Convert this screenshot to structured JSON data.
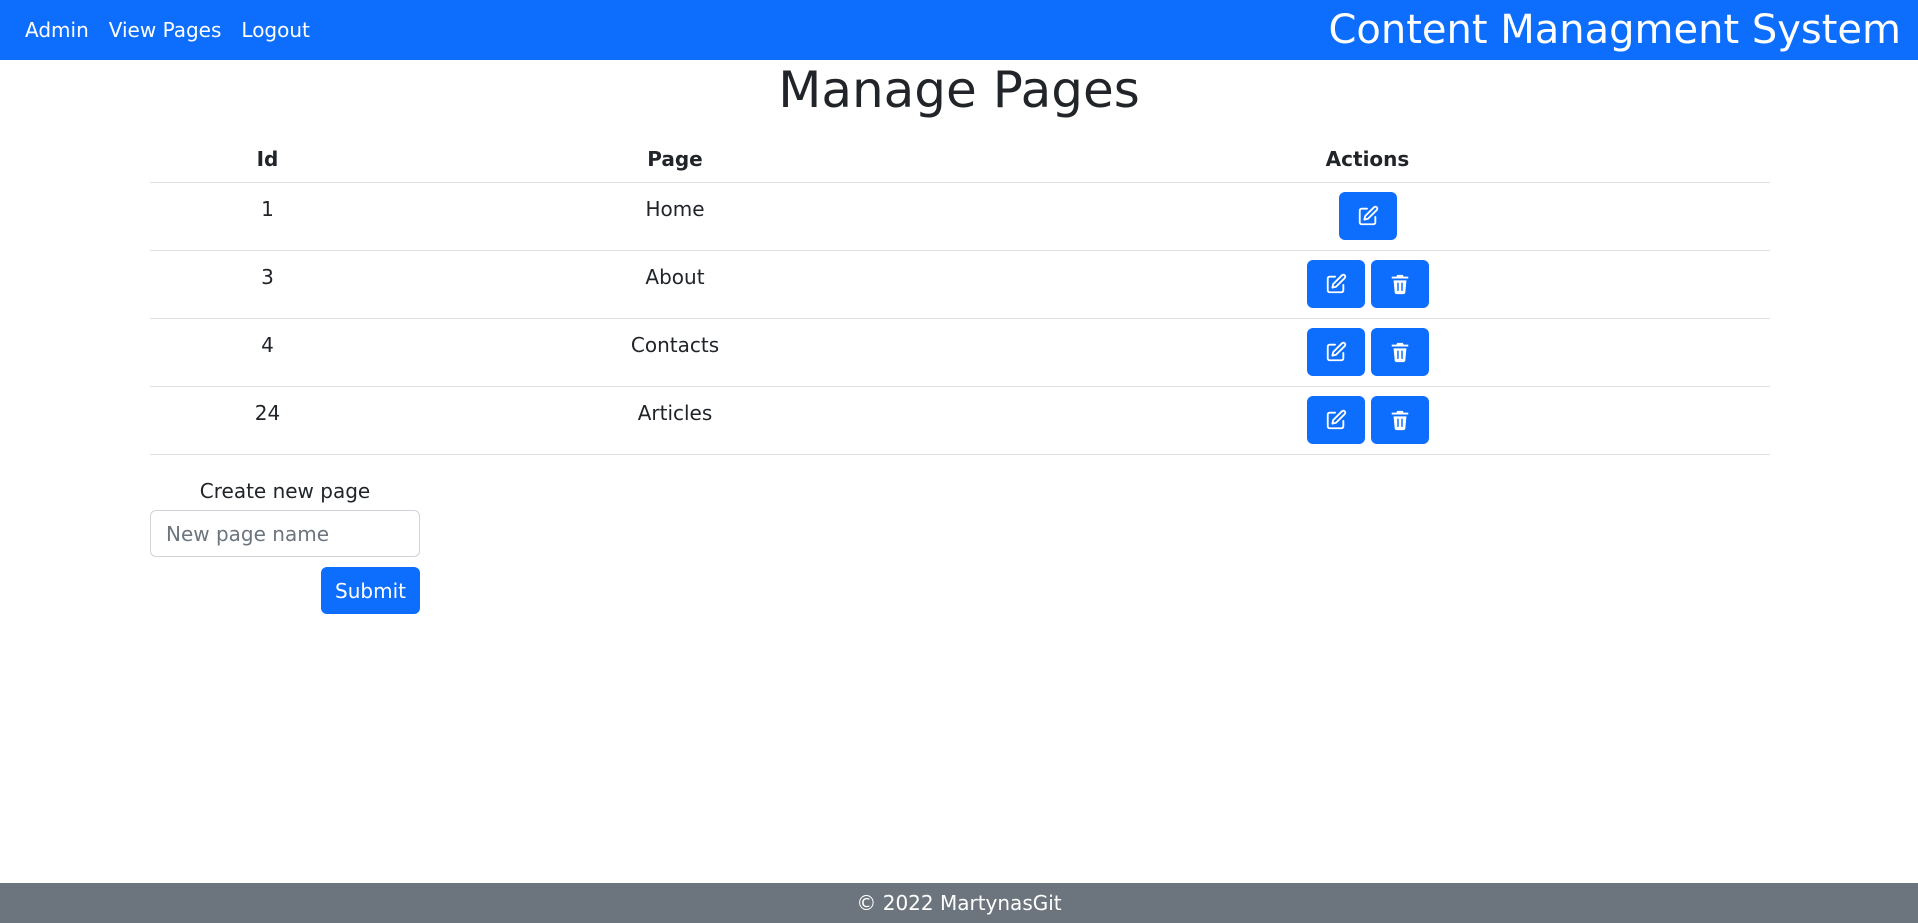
{
  "nav": {
    "links": [
      "Admin",
      "View Pages",
      "Logout"
    ],
    "brand": "Content Managment System"
  },
  "page_title": "Manage Pages",
  "table": {
    "headers": [
      "Id",
      "Page",
      "Actions"
    ],
    "rows": [
      {
        "id": "1",
        "page": "Home",
        "actions": [
          "edit-icon"
        ]
      },
      {
        "id": "3",
        "page": "About",
        "actions": [
          "edit-icon",
          "trash-icon"
        ]
      },
      {
        "id": "4",
        "page": "Contacts",
        "actions": [
          "edit-icon",
          "trash-icon"
        ]
      },
      {
        "id": "24",
        "page": "Articles",
        "actions": [
          "edit-icon",
          "trash-icon"
        ]
      }
    ]
  },
  "create": {
    "label": "Create new page",
    "placeholder": "New page name",
    "submit_label": "Submit"
  },
  "footer": {
    "text": "© 2022 MartynasGit"
  },
  "colors": {
    "primary": "#0d6efd",
    "footer_bg": "#6c757d",
    "text": "#212529"
  }
}
